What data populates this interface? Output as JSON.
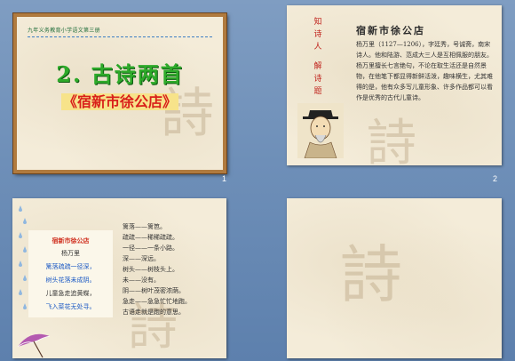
{
  "slides": [
    {
      "number": "1",
      "header": "九年义务教育小学语文第三册",
      "title": "2. 古诗两首",
      "subtitle": "《宿新市徐公店》"
    },
    {
      "number": "2",
      "side_labels": [
        "知",
        "诗",
        "人",
        "",
        "解",
        "诗",
        "题"
      ],
      "title": "宿新市徐公店",
      "body": "杨万里（1127—1206），字廷秀，号诚斋，南宋诗人。他和陆游、范成大三人是互相佩服的朋友。杨万里擅长七言绝句，不论在取生活还是自然景物，在他笔下都显得新鲜活泼，趣味横生，尤其难得的是，他有众多写儿童形象、许多作品都可以看作是优秀的古代儿童诗。"
    },
    {
      "number": "",
      "poem": {
        "title": "宿新市徐公店",
        "author": "杨万里",
        "lines": [
          "篱落疏疏一径深，",
          "树头花落未成阴。",
          "儿童急走追黄蝶，",
          "飞入菜花无处寻。"
        ]
      },
      "notes": [
        "篱落——篱笆。",
        "疏疏——稀稀疏疏。",
        "一径——一条小路。",
        "深——深远。",
        "树头——树枝头上。",
        "未——没有。",
        "阴——树叶茂密浓荫。",
        "急走——急急忙忙地跑。",
        "古语走就是跑的意思。"
      ]
    },
    {
      "number": ""
    }
  ]
}
